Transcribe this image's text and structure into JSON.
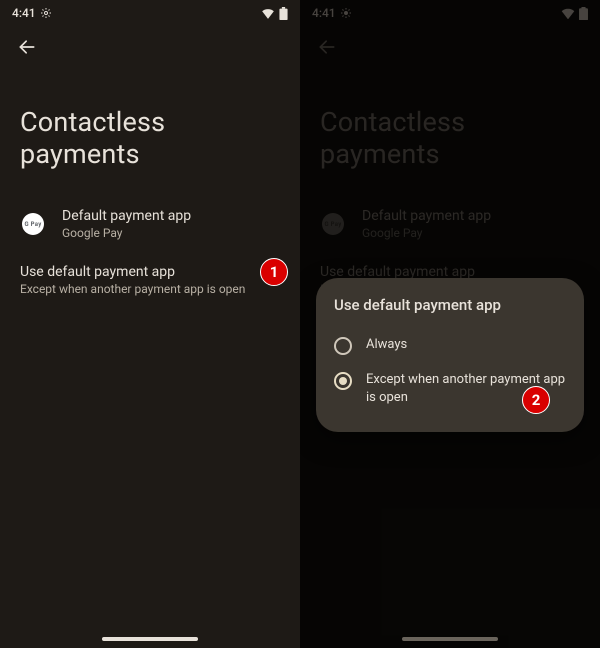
{
  "status": {
    "time": "4:41"
  },
  "page": {
    "title": "Contactless payments",
    "default_app": {
      "label": "Default payment app",
      "value": "Google Pay",
      "icon_name": "gpay-icon",
      "icon_text": "G Pay"
    },
    "use_default": {
      "label": "Use default payment app",
      "value": "Except when another payment app is open"
    }
  },
  "dialog": {
    "title": "Use default payment app",
    "options": [
      {
        "label": "Always",
        "selected": false
      },
      {
        "label": "Except when another payment app is open",
        "selected": true
      }
    ]
  },
  "annotations": {
    "badge1": "1",
    "badge2": "2"
  }
}
